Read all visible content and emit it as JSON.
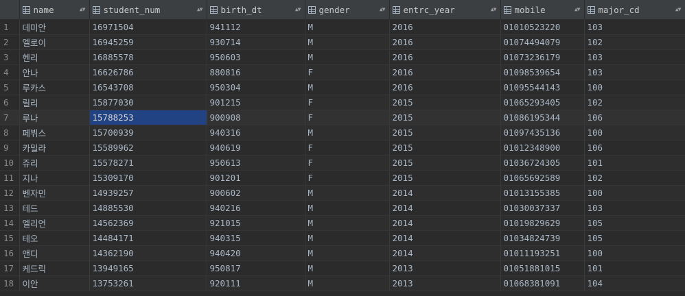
{
  "columns": [
    {
      "label": "name"
    },
    {
      "label": "student_num"
    },
    {
      "label": "birth_dt"
    },
    {
      "label": "gender"
    },
    {
      "label": "entrc_year"
    },
    {
      "label": "mobile"
    },
    {
      "label": "major_cd"
    }
  ],
  "rows": [
    {
      "n": "1",
      "name": "데미안",
      "student_num": "16971504",
      "birth_dt": "941112",
      "gender": "M",
      "entrc_year": "2016",
      "mobile": "01010523220",
      "major_cd": "103"
    },
    {
      "n": "2",
      "name": "엘로이",
      "student_num": "16945259",
      "birth_dt": "930714",
      "gender": "M",
      "entrc_year": "2016",
      "mobile": "01074494079",
      "major_cd": "102"
    },
    {
      "n": "3",
      "name": "헨리",
      "student_num": "16885578",
      "birth_dt": "950603",
      "gender": "M",
      "entrc_year": "2016",
      "mobile": "01073236179",
      "major_cd": "103"
    },
    {
      "n": "4",
      "name": "안나",
      "student_num": "16626786",
      "birth_dt": "880816",
      "gender": "F",
      "entrc_year": "2016",
      "mobile": "01098539654",
      "major_cd": "103"
    },
    {
      "n": "5",
      "name": "루카스",
      "student_num": "16543708",
      "birth_dt": "950304",
      "gender": "M",
      "entrc_year": "2016",
      "mobile": "01095544143",
      "major_cd": "100"
    },
    {
      "n": "6",
      "name": "릴리",
      "student_num": "15877030",
      "birth_dt": "901215",
      "gender": "F",
      "entrc_year": "2015",
      "mobile": "01065293405",
      "major_cd": "102"
    },
    {
      "n": "7",
      "name": "루나",
      "student_num": "15788253",
      "birth_dt": "900908",
      "gender": "F",
      "entrc_year": "2015",
      "mobile": "01086195344",
      "major_cd": "106"
    },
    {
      "n": "8",
      "name": "페뷔스",
      "student_num": "15700939",
      "birth_dt": "940316",
      "gender": "M",
      "entrc_year": "2015",
      "mobile": "01097435136",
      "major_cd": "100"
    },
    {
      "n": "9",
      "name": "카밀라",
      "student_num": "15589962",
      "birth_dt": "940619",
      "gender": "F",
      "entrc_year": "2015",
      "mobile": "01012348900",
      "major_cd": "106"
    },
    {
      "n": "10",
      "name": "쥬리",
      "student_num": "15578271",
      "birth_dt": "950613",
      "gender": "F",
      "entrc_year": "2015",
      "mobile": "01036724305",
      "major_cd": "101"
    },
    {
      "n": "11",
      "name": "지나",
      "student_num": "15309170",
      "birth_dt": "901201",
      "gender": "F",
      "entrc_year": "2015",
      "mobile": "01065692589",
      "major_cd": "102"
    },
    {
      "n": "12",
      "name": "벤자민",
      "student_num": "14939257",
      "birth_dt": "900602",
      "gender": "M",
      "entrc_year": "2014",
      "mobile": "01013155385",
      "major_cd": "100"
    },
    {
      "n": "13",
      "name": "테드",
      "student_num": "14885530",
      "birth_dt": "940216",
      "gender": "M",
      "entrc_year": "2014",
      "mobile": "01030037337",
      "major_cd": "103"
    },
    {
      "n": "14",
      "name": "엘리언",
      "student_num": "14562369",
      "birth_dt": "921015",
      "gender": "M",
      "entrc_year": "2014",
      "mobile": "01019829629",
      "major_cd": "105"
    },
    {
      "n": "15",
      "name": "테오",
      "student_num": "14484171",
      "birth_dt": "940315",
      "gender": "M",
      "entrc_year": "2014",
      "mobile": "01034824739",
      "major_cd": "105"
    },
    {
      "n": "16",
      "name": "앤디",
      "student_num": "14362190",
      "birth_dt": "940420",
      "gender": "M",
      "entrc_year": "2014",
      "mobile": "01011193251",
      "major_cd": "100"
    },
    {
      "n": "17",
      "name": "케드릭",
      "student_num": "13949165",
      "birth_dt": "950817",
      "gender": "M",
      "entrc_year": "2013",
      "mobile": "01051881015",
      "major_cd": "101"
    },
    {
      "n": "18",
      "name": "이안",
      "student_num": "13753261",
      "birth_dt": "920111",
      "gender": "M",
      "entrc_year": "2013",
      "mobile": "01068381091",
      "major_cd": "104"
    }
  ],
  "selection": {
    "row": 7,
    "column": "student_num"
  },
  "colors": {
    "background": "#2b2b2b",
    "header": "#3c3f41",
    "selected_cell": "#214283",
    "text": "#a9b7c6"
  },
  "icons": {
    "column_header": "table-column-icon",
    "sort": "sort-arrows-icon"
  }
}
